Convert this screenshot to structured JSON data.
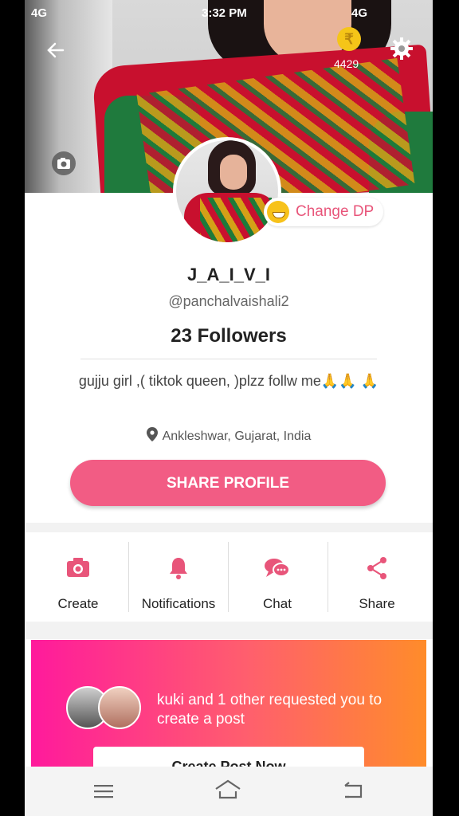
{
  "status_bar": {
    "left": "4G",
    "time": "3:32 PM",
    "right": "4G"
  },
  "coins": {
    "icon": "rupee-coin-icon",
    "symbol": "₹",
    "count": "4429"
  },
  "profile": {
    "change_dp_label": "Change DP",
    "name": "J_A_I_V_I",
    "handle": "@panchalvaishali2",
    "followers": "23 Followers",
    "bio": "gujju girl ,( tiktok queen, )plzz follw me🙏🙏 🙏",
    "location": "Ankleshwar, Gujarat, India",
    "share_button": "SHARE PROFILE"
  },
  "actions": [
    {
      "label": "Create",
      "icon": "camera-icon"
    },
    {
      "label": "Notifications",
      "icon": "bell-icon"
    },
    {
      "label": "Chat",
      "icon": "chat-bubbles-icon"
    },
    {
      "label": "Share",
      "icon": "share-icon"
    }
  ],
  "banner": {
    "text": "kuki and 1 other requested you to create a post",
    "button": "Create Post Now"
  },
  "colors": {
    "accent": "#f25c84",
    "banner_start": "#ff1a9c",
    "banner_end": "#ff8c2a",
    "icon": "#e8557a"
  }
}
